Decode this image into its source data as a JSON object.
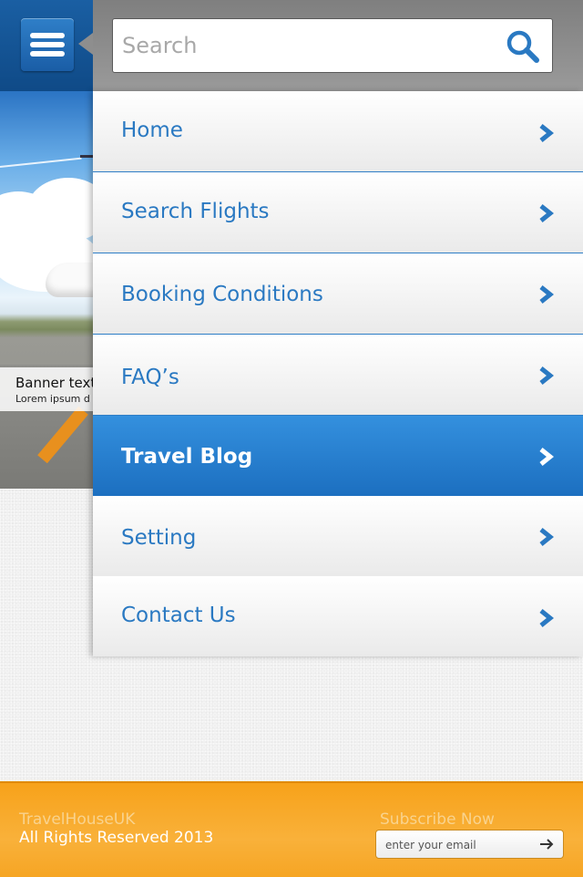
{
  "search": {
    "placeholder": "Search",
    "value": ""
  },
  "banner": {
    "title": "Banner text",
    "text": "Lorem ipsum d"
  },
  "menu": {
    "items": [
      {
        "label": "Home",
        "active": false
      },
      {
        "label": "Search Flights",
        "active": false
      },
      {
        "label": "Booking Conditions",
        "active": false
      },
      {
        "label": "FAQ’s",
        "active": false
      },
      {
        "label": "Travel Blog",
        "active": true
      },
      {
        "label": "Setting",
        "active": false
      },
      {
        "label": "Contact Us",
        "active": false
      }
    ]
  },
  "footer": {
    "brand": "TravelHouseUK",
    "rights": "All Rights Reserved 2013",
    "subscribe_label": "Subscribe Now",
    "email_placeholder": "enter your email"
  },
  "colors": {
    "accent_blue": "#2a79c2",
    "active_blue": "#2a82d2",
    "footer_orange": "#f7a21a"
  },
  "icons": {
    "menu": "hamburger-icon",
    "search": "search-icon",
    "chevron": "chevron-right-icon",
    "submit": "arrow-right-icon"
  }
}
